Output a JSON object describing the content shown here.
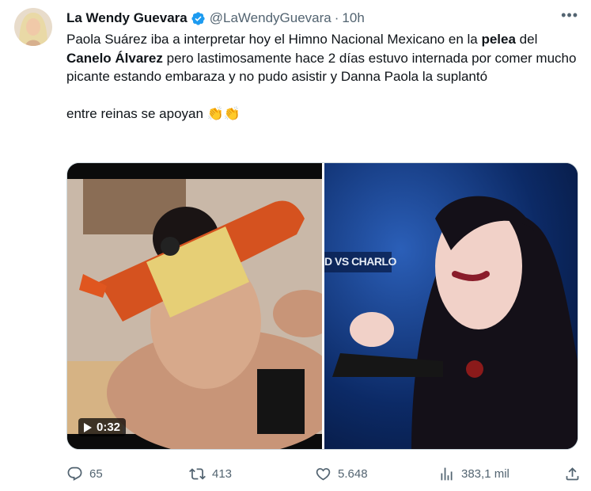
{
  "author": {
    "display_name": "La Wendy Guevara",
    "handle": "@LaWendyGuevara",
    "separator": "·",
    "time": "10h",
    "verified_color": "#1d9bf0"
  },
  "more_label": "•••",
  "tweet": {
    "p1_a": "Paola Suárez iba a interpretar hoy el Himno Nacional Mexicano en la ",
    "p1_b": "pelea",
    "p1_c": " del ",
    "p1_d": "Canelo Álvarez",
    "p1_e": " pero lastimosamente hace 2 días estuvo internada por comer mucho picante estando embaraza y no pudo asistir y Danna Paola la suplantó",
    "p2_text": "entre reinas se apoyan ",
    "p2_emoji": "👏👏"
  },
  "media": {
    "video_duration": "0:32",
    "right_banner_text": "D VS CHARLO"
  },
  "actions": {
    "replies": "65",
    "reposts": "413",
    "likes": "5.648",
    "views": "383,1 mil"
  },
  "icons": {
    "verified": "verified-badge-icon",
    "reply": "reply-icon",
    "repost": "repost-icon",
    "like": "heart-icon",
    "views": "views-icon",
    "share": "share-icon"
  }
}
